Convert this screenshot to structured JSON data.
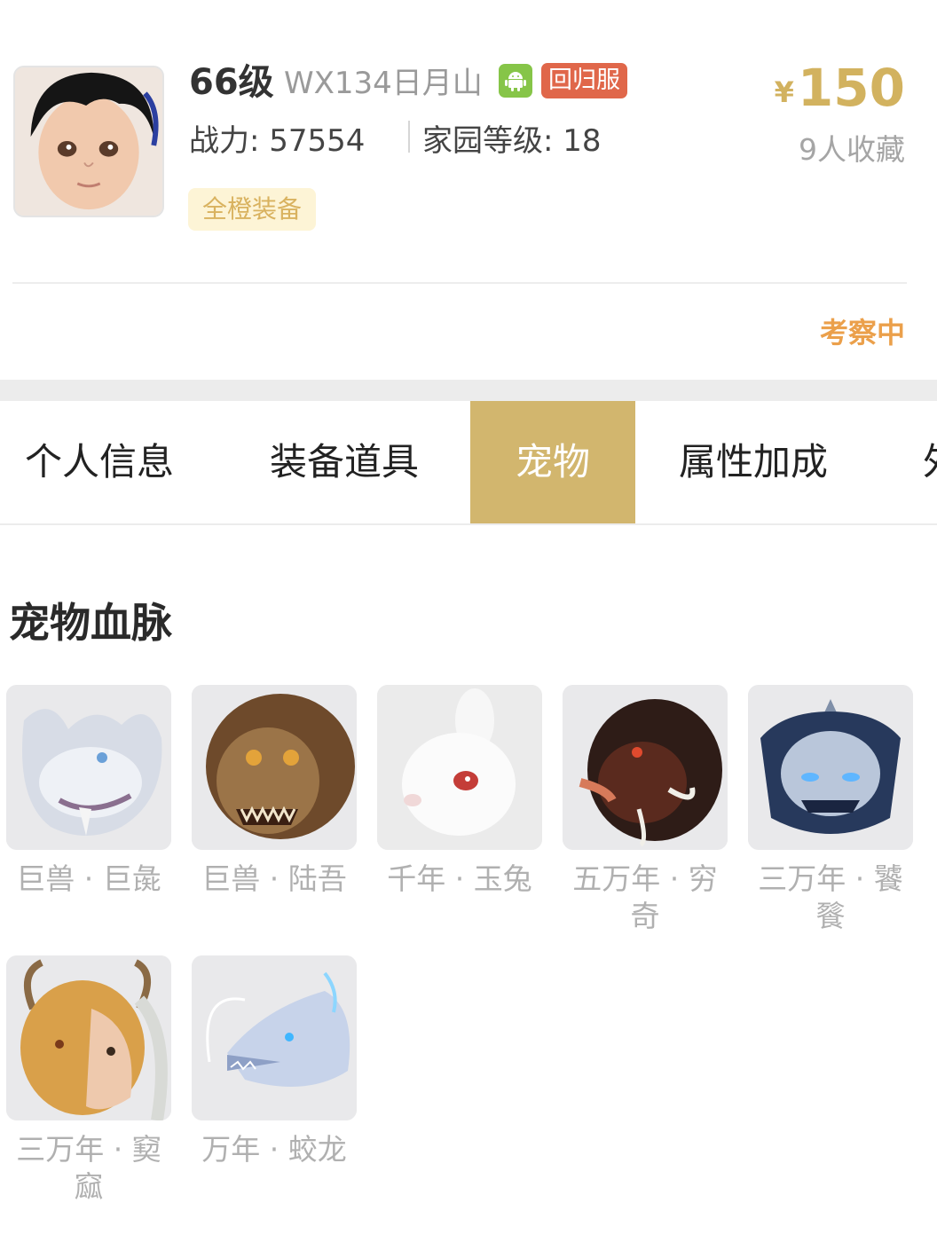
{
  "profile": {
    "avatar_icon": "character-portrait",
    "level": "66级",
    "server": "WX134日月山",
    "platform_icon": "android-icon",
    "return_badge": "回归服",
    "power": "战力: 57554",
    "home_level": "家园等级: 18",
    "equip_tag": "全橙装备",
    "currency": "¥",
    "price": "150",
    "favorites": "9人收藏",
    "status": "考察中"
  },
  "tabs": [
    {
      "label": "个人信息",
      "active": false
    },
    {
      "label": "装备道具",
      "active": false
    },
    {
      "label": "宠物",
      "active": true
    },
    {
      "label": "属性加成",
      "active": false
    },
    {
      "label": "外",
      "active": false
    }
  ],
  "pets": {
    "title": "宠物血脉",
    "items": [
      {
        "name": "巨兽 · 巨彘",
        "icon": "white-beast-head"
      },
      {
        "name": "巨兽 · 陆吾",
        "icon": "lion-beast-head"
      },
      {
        "name": "千年 · 玉兔",
        "icon": "white-rabbit-head"
      },
      {
        "name": "五万年 · 穷奇",
        "icon": "dark-beast-head"
      },
      {
        "name": "三万年 · 饕餮",
        "icon": "blue-armored-beast-head"
      },
      {
        "name": "三万年 · 窫窳",
        "icon": "horned-beast-head"
      },
      {
        "name": "万年 · 蛟龙",
        "icon": "ice-dragon-head"
      }
    ]
  },
  "colors": {
    "accent_gold": "#d2b66e",
    "price_gold": "#d2b25f",
    "status_orange": "#eba04b",
    "badge_red": "#e0674a",
    "android_green": "#86c548"
  }
}
